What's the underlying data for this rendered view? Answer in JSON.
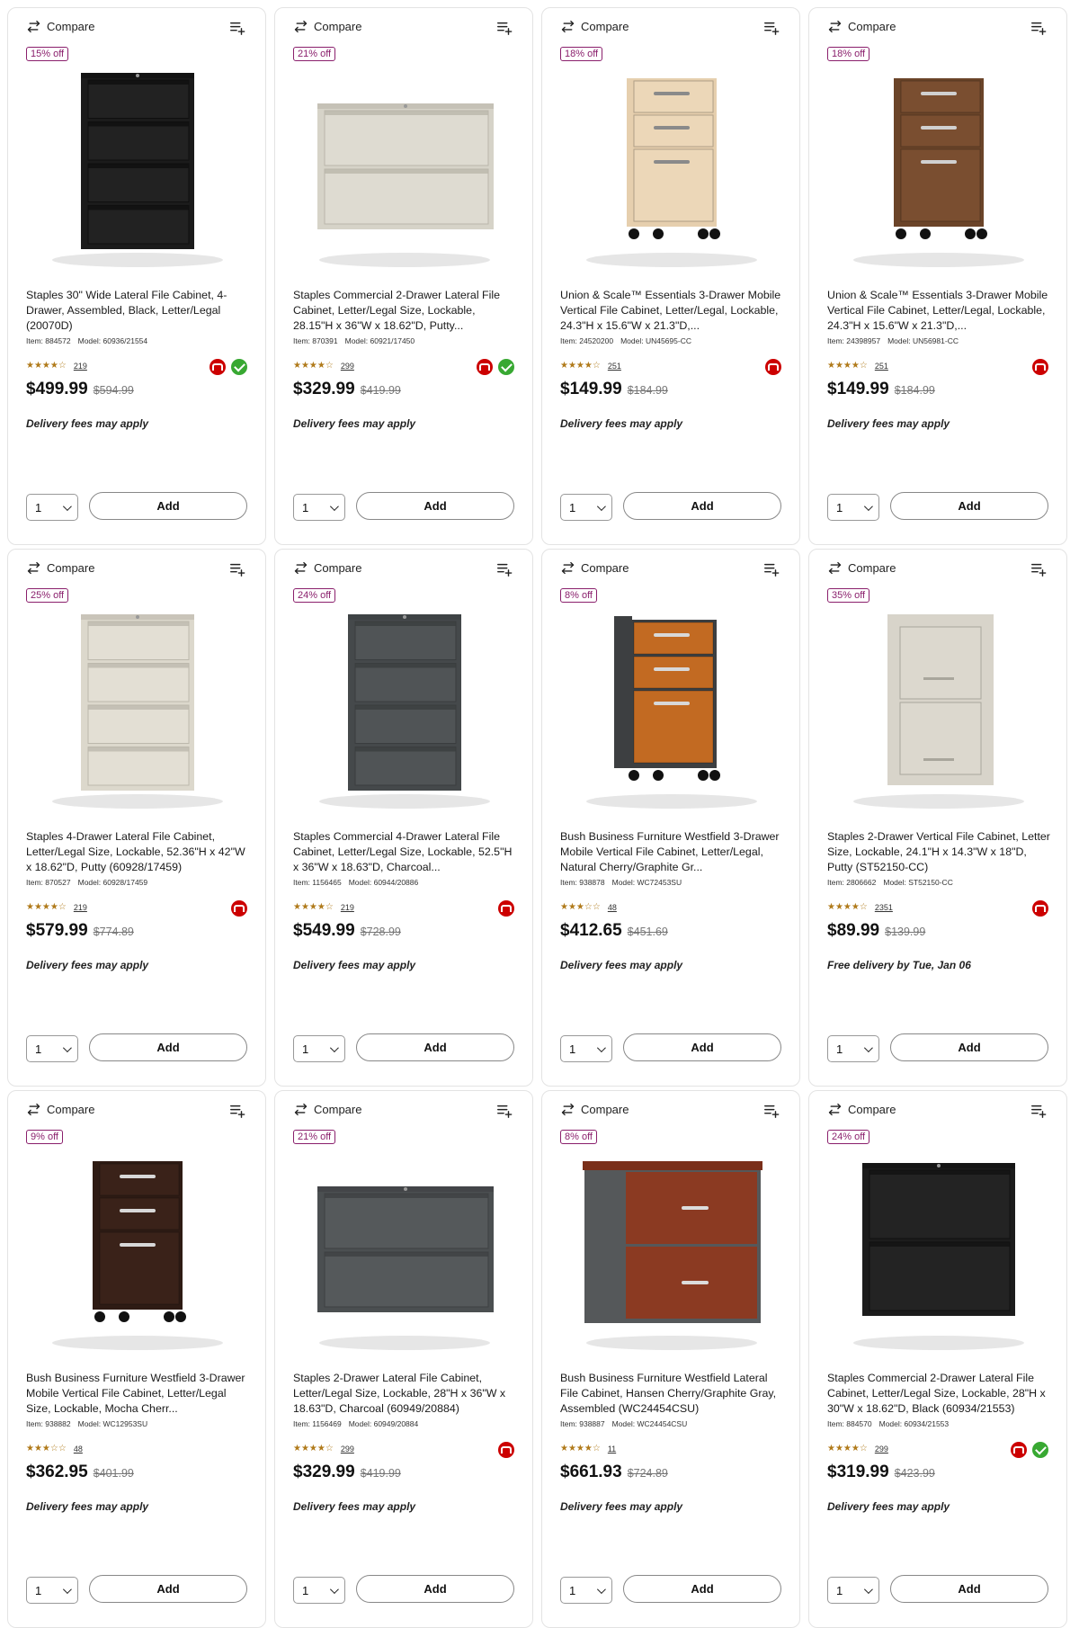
{
  "compare_label": "Compare",
  "add_label": "Add",
  "colors": {
    "discount": "#8a1f6c",
    "badge_red": "#cc0000",
    "badge_green": "#38a832",
    "star": "#b07a1a"
  },
  "products": [
    {
      "discount": "15% off",
      "title": "Staples 30\" Wide Lateral File Cabinet, 4-Drawer, Assembled, Black, Letter/Legal (20070D)",
      "item": "Item: 884572",
      "model": "Model: 60936/21554",
      "stars": "★★★★☆",
      "rating": 4.5,
      "reviews": "219",
      "price": "$499.99",
      "old_price": "$594.99",
      "delivery": "Delivery fees may apply",
      "qty": "1",
      "badges": [
        "red",
        "green"
      ],
      "image": {
        "kind": "lateral",
        "drawers": 4,
        "body": "#1b1b1b",
        "front": "#222222",
        "handle": "#0f0f0f"
      }
    },
    {
      "discount": "21% off",
      "title": "Staples Commercial 2-Drawer Lateral File Cabinet, Letter/Legal Size, Lockable, 28.15\"H x 36\"W x 18.62\"D, Putty...",
      "item": "Item: 870391",
      "model": "Model: 60921/17450",
      "stars": "★★★★☆",
      "rating": 4.5,
      "reviews": "299",
      "price": "$329.99",
      "old_price": "$419.99",
      "delivery": "Delivery fees may apply",
      "qty": "1",
      "badges": [
        "red",
        "green"
      ],
      "image": {
        "kind": "wide",
        "drawers": 2,
        "body": "#d6d3c8",
        "front": "#dedbd1",
        "handle": "#b9b6aa"
      }
    },
    {
      "discount": "18% off",
      "title": "Union & Scale™ Essentials 3-Drawer Mobile Vertical File Cabinet, Letter/Legal, Lockable, 24.3\"H x 15.6\"W x 21.3\"D,...",
      "item": "Item: 24520200",
      "model": "Model: UN45695-CC",
      "stars": "★★★★☆",
      "rating": 4.5,
      "reviews": "251",
      "price": "$149.99",
      "old_price": "$184.99",
      "delivery": "Delivery fees may apply",
      "qty": "1",
      "badges": [
        "red"
      ],
      "image": {
        "kind": "pedestal",
        "drawers": 3,
        "body": "#e6cfae",
        "front": "#ecd7b8",
        "handle": "#8a8a8a"
      }
    },
    {
      "discount": "18% off",
      "title": "Union & Scale™ Essentials 3-Drawer Mobile Vertical File Cabinet, Letter/Legal, Lockable, 24.3\"H x 15.6\"W x 21.3\"D,...",
      "item": "Item: 24398957",
      "model": "Model: UN56981-CC",
      "stars": "★★★★☆",
      "rating": 4.5,
      "reviews": "251",
      "price": "$149.99",
      "old_price": "$184.99",
      "delivery": "Delivery fees may apply",
      "qty": "1",
      "badges": [
        "red"
      ],
      "image": {
        "kind": "pedestal",
        "drawers": 3,
        "body": "#6b4429",
        "front": "#7a4e30",
        "handle": "#d0d0d0"
      }
    },
    {
      "discount": "25% off",
      "title": "Staples 4-Drawer Lateral File Cabinet, Letter/Legal Size, Lockable, 52.36\"H x 42\"W x 18.62\"D, Putty (60928/17459)",
      "item": "Item: 870527",
      "model": "Model: 60928/17459",
      "stars": "★★★★☆",
      "rating": 4.5,
      "reviews": "219",
      "price": "$579.99",
      "old_price": "$774.89",
      "delivery": "Delivery fees may apply",
      "qty": "1",
      "badges": [
        "red"
      ],
      "image": {
        "kind": "lateral",
        "drawers": 4,
        "body": "#dcd8cc",
        "front": "#e3dfd4",
        "handle": "#bcb8ac"
      }
    },
    {
      "discount": "24% off",
      "title": "Staples Commercial 4-Drawer Lateral File Cabinet, Letter/Legal Size, Lockable, 52.5\"H x 36\"W x 18.63\"D, Charcoal...",
      "item": "Item: 1156465",
      "model": "Model: 60944/20886",
      "stars": "★★★★☆",
      "rating": 4.5,
      "reviews": "219",
      "price": "$549.99",
      "old_price": "$728.99",
      "delivery": "Delivery fees may apply",
      "qty": "1",
      "badges": [
        "red"
      ],
      "image": {
        "kind": "lateral",
        "drawers": 4,
        "body": "#45494b",
        "front": "#505456",
        "handle": "#3a3d3f"
      }
    },
    {
      "discount": "8% off",
      "title": "Bush Business Furniture Westfield 3-Drawer Mobile Vertical File Cabinet, Letter/Legal, Natural Cherry/Graphite Gr...",
      "item": "Item: 938878",
      "model": "Model: WC72453SU",
      "stars": "★★★☆☆",
      "rating": 3.5,
      "reviews": "48",
      "price": "$412.65",
      "old_price": "$451.69",
      "delivery": "Delivery fees may apply",
      "qty": "1",
      "badges": [],
      "image": {
        "kind": "pedestal2",
        "drawers": 3,
        "body": "#3d3f41",
        "front": "#c26a22",
        "handle": "#d8d8d8"
      }
    },
    {
      "discount": "35% off",
      "title": "Staples 2-Drawer Vertical File Cabinet, Letter Size, Lockable, 24.1\"H x 14.3\"W x 18\"D, Putty (ST52150-CC)",
      "item": "Item: 2806662",
      "model": "Model: ST52150-CC",
      "stars": "★★★★☆",
      "rating": 4.5,
      "reviews": "2351",
      "price": "$89.99",
      "old_price": "$139.99",
      "delivery": "Free delivery by Tue, Jan 06",
      "qty": "1",
      "badges": [
        "red"
      ],
      "image": {
        "kind": "vertical",
        "drawers": 2,
        "body": "#d8d4ca",
        "front": "#dcd8ce",
        "handle": "#a9a69c"
      }
    },
    {
      "discount": "9% off",
      "title": "Bush Business Furniture Westfield 3-Drawer Mobile Vertical File Cabinet, Letter/Legal Size, Lockable, Mocha Cherr...",
      "item": "Item: 938882",
      "model": "Model: WC12953SU",
      "stars": "★★★☆☆",
      "rating": 3.5,
      "reviews": "48",
      "price": "$362.95",
      "old_price": "$401.99",
      "delivery": "Delivery fees may apply",
      "qty": "1",
      "badges": [],
      "image": {
        "kind": "pedestal",
        "drawers": 3,
        "body": "#2e1b14",
        "front": "#3a2219",
        "handle": "#d8d8d8"
      }
    },
    {
      "discount": "21% off",
      "title": "Staples 2-Drawer Lateral File Cabinet, Letter/Legal Size, Lockable, 28\"H x 36\"W x 18.63\"D, Charcoal (60949/20884)",
      "item": "Item: 1156469",
      "model": "Model: 60949/20884",
      "stars": "★★★★☆",
      "rating": 4.5,
      "reviews": "299",
      "price": "$329.99",
      "old_price": "$419.99",
      "delivery": "Delivery fees may apply",
      "qty": "1",
      "badges": [
        "red"
      ],
      "image": {
        "kind": "wide",
        "drawers": 2,
        "body": "#4b4f51",
        "front": "#55595b",
        "handle": "#3d4042"
      }
    },
    {
      "discount": "8% off",
      "title": "Bush Business Furniture Westfield Lateral File Cabinet, Hansen Cherry/Graphite Gray, Assembled (WC24454CSU)",
      "item": "Item: 938887",
      "model": "Model: WC24454CSU",
      "stars": "★★★★☆",
      "rating": 4,
      "reviews": "11",
      "price": "$661.93",
      "old_price": "$724.89",
      "delivery": "Delivery fees may apply",
      "qty": "1",
      "badges": [],
      "image": {
        "kind": "wood-lateral",
        "drawers": 2,
        "body": "#55585a",
        "front": "#8b3a22",
        "handle": "#dcdcdc"
      }
    },
    {
      "discount": "24% off",
      "title": "Staples Commercial 2-Drawer Lateral File Cabinet, Letter/Legal Size, Lockable, 28\"H x 30\"W x 18.62\"D, Black (60934/21553)",
      "item": "Item: 884570",
      "model": "Model: 60934/21553",
      "stars": "★★★★☆",
      "rating": 4.5,
      "reviews": "299",
      "price": "$319.99",
      "old_price": "$423.99",
      "delivery": "Delivery fees may apply",
      "qty": "1",
      "badges": [
        "red",
        "green"
      ],
      "image": {
        "kind": "wide-tall",
        "drawers": 2,
        "body": "#1c1c1c",
        "front": "#232323",
        "handle": "#111111"
      }
    }
  ]
}
